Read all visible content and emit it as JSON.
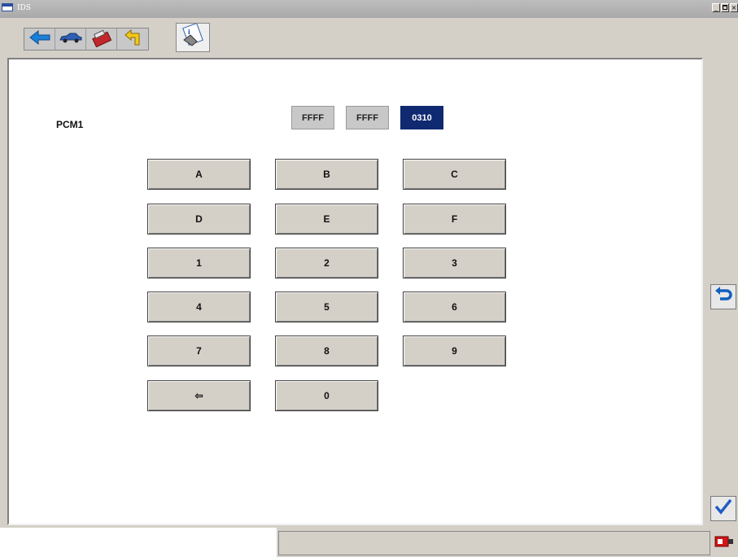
{
  "window": {
    "title": "IDS",
    "controls": [
      "_",
      "\u0018",
      "×"
    ]
  },
  "module": {
    "label": "PCM1"
  },
  "fields": [
    {
      "value": "FFFF",
      "state": "inactive"
    },
    {
      "value": "FFFF",
      "state": "inactive"
    },
    {
      "value": "0310",
      "state": "active"
    }
  ],
  "keypad": {
    "rows": [
      [
        "A",
        "B",
        "C"
      ],
      [
        "D",
        "E",
        "F"
      ],
      [
        "1",
        "2",
        "3"
      ],
      [
        "4",
        "5",
        "6"
      ],
      [
        "7",
        "8",
        "9"
      ],
      [
        "⇦",
        "0"
      ]
    ]
  },
  "toolbar": {
    "icons": [
      "back-arrow-icon",
      "vehicle-icon",
      "toolbox-icon",
      "return-arrow-icon"
    ],
    "active_icon": "hand-note-icon"
  },
  "sidebar": {
    "undo_icon": "undo-arrow-icon",
    "confirm_icon": "check-icon"
  },
  "colors": {
    "active_field": "#0f2a70",
    "accent_blue": "#1060c0",
    "check_blue": "#1f5bc4"
  }
}
